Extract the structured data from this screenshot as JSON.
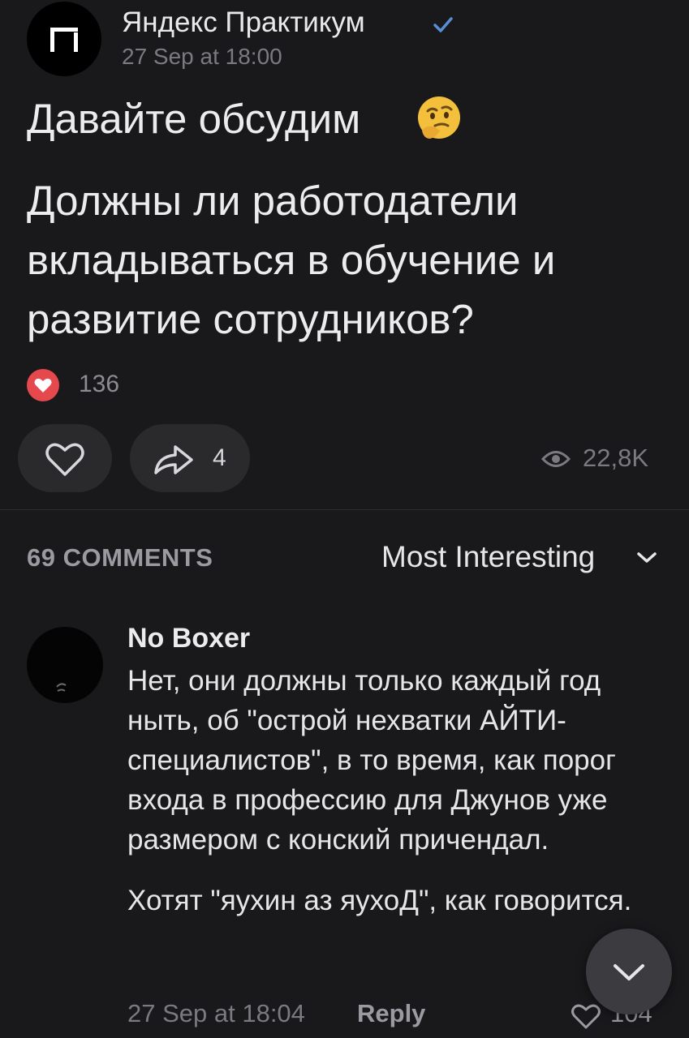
{
  "post": {
    "author": "Яндекс Практикум",
    "date": "27 Sep at 18:00",
    "headline": "Давайте обсудим",
    "body": "Должны ли работодатели вкладываться в обучение и развитие сотрудников?",
    "reaction_count": "136",
    "share_count": "4",
    "views_count": "22,8K"
  },
  "comments_header": {
    "count_label": "69 COMMENTS",
    "sort_label": "Most Interesting"
  },
  "comment": {
    "author": "No Boxer",
    "paragraph1": "Нет, они должны только каждый год ныть, об \"острой нехватки АЙТИ-специалистов\", в то время, как порог входа в профессию для Джунов уже размером с конский причендал.",
    "paragraph2": "Хотят \"яухин аз яухоД\", как говорится.",
    "date": "27 Sep at 18:04",
    "reply_label": "Reply",
    "like_count": "104"
  },
  "colors": {
    "background": "#19191b",
    "accent_verified": "#5a8dd6",
    "reaction_red": "#e5484d",
    "pill": "#2a2a2d"
  },
  "icons": [
    "verified-icon",
    "thinking-face-emoji",
    "heart-reaction-icon",
    "heart-outline-icon",
    "share-arrow-icon",
    "eye-icon",
    "chevron-down-icon"
  ]
}
